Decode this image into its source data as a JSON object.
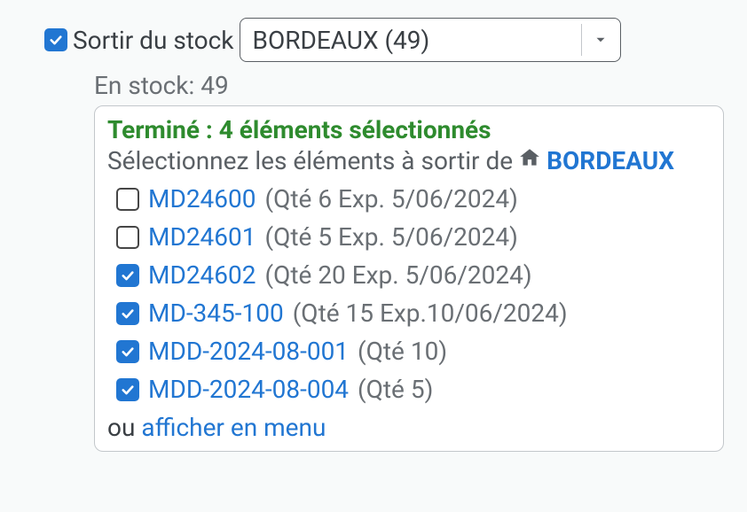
{
  "topCheckboxChecked": true,
  "topLabel": "Sortir du stock",
  "dropdown": {
    "value": "BORDEAUX (49)"
  },
  "stockLine": "En stock: 49",
  "statusLine": "Terminé : 4 éléments sélectionnés",
  "instructPrefix": "Sélectionnez les éléments à sortir de",
  "location": "BORDEAUX",
  "items": [
    {
      "checked": false,
      "code": "MD24600",
      "detail": "(Qté 6 Exp. 5/06/2024)"
    },
    {
      "checked": false,
      "code": "MD24601",
      "detail": "(Qté 5 Exp. 5/06/2024)"
    },
    {
      "checked": true,
      "code": "MD24602",
      "detail": "(Qté 20 Exp. 5/06/2024)"
    },
    {
      "checked": true,
      "code": "MD-345-100",
      "detail": "(Qté 15 Exp.10/06/2024)"
    },
    {
      "checked": true,
      "code": "MDD-2024-08-001",
      "detail": "(Qté 10)"
    },
    {
      "checked": true,
      "code": "MDD-2024-08-004",
      "detail": "(Qté 5)"
    }
  ],
  "footerPrefix": "ou ",
  "footerLink": "afficher en menu"
}
